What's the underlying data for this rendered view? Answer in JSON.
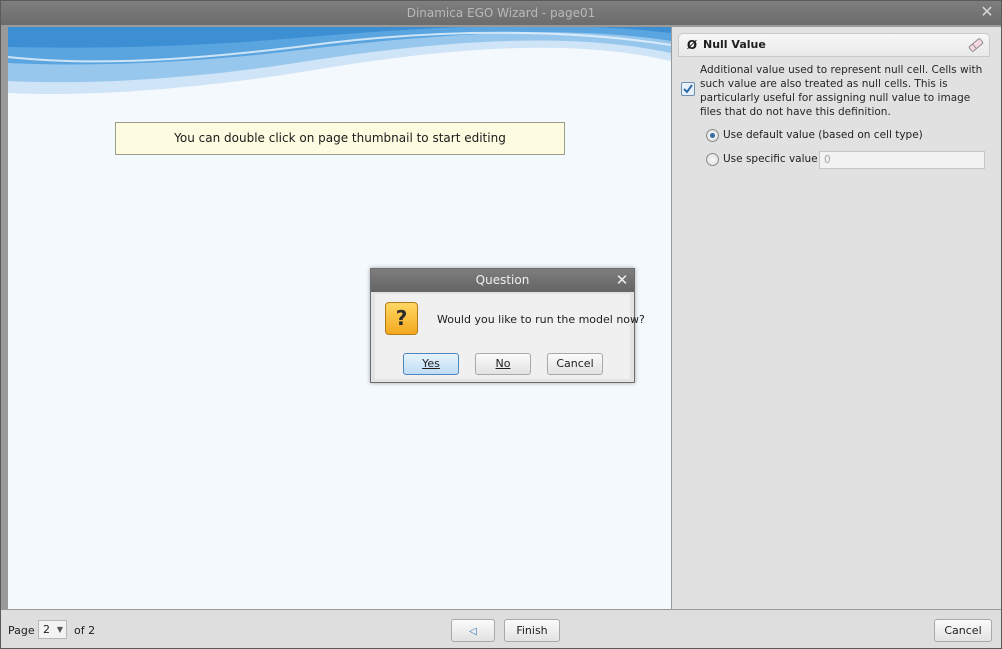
{
  "window": {
    "title": "Dinamica EGO Wizard - page01"
  },
  "canvas": {
    "hint": "You can double click on page thumbnail to start editing"
  },
  "property": {
    "title": "Null Value",
    "enabled": true,
    "description": "Additional value used to represent null cell. Cells with such value are also treated as null cells. This is particularly useful for assigning null value to image files that do not have this definition.",
    "options": [
      {
        "label": "Use default value (based on cell type)",
        "selected": true
      },
      {
        "label": "Use specific value",
        "selected": false
      }
    ],
    "specific_value": "0"
  },
  "footer": {
    "page_label": "Page",
    "page_current": "2",
    "page_total": "of 2",
    "finish_label": "Finish",
    "cancel_label": "Cancel"
  },
  "dialog": {
    "title": "Question",
    "message": "Would you like to run the model now?",
    "yes_label": "Yes",
    "no_label": "No",
    "cancel_label": "Cancel"
  },
  "colors": {
    "canvas_bg": "#f4f9fe",
    "hint_bg": "#fdfce1",
    "wave_primary": "#5aa5e0",
    "accent": "#2f6ea8"
  }
}
